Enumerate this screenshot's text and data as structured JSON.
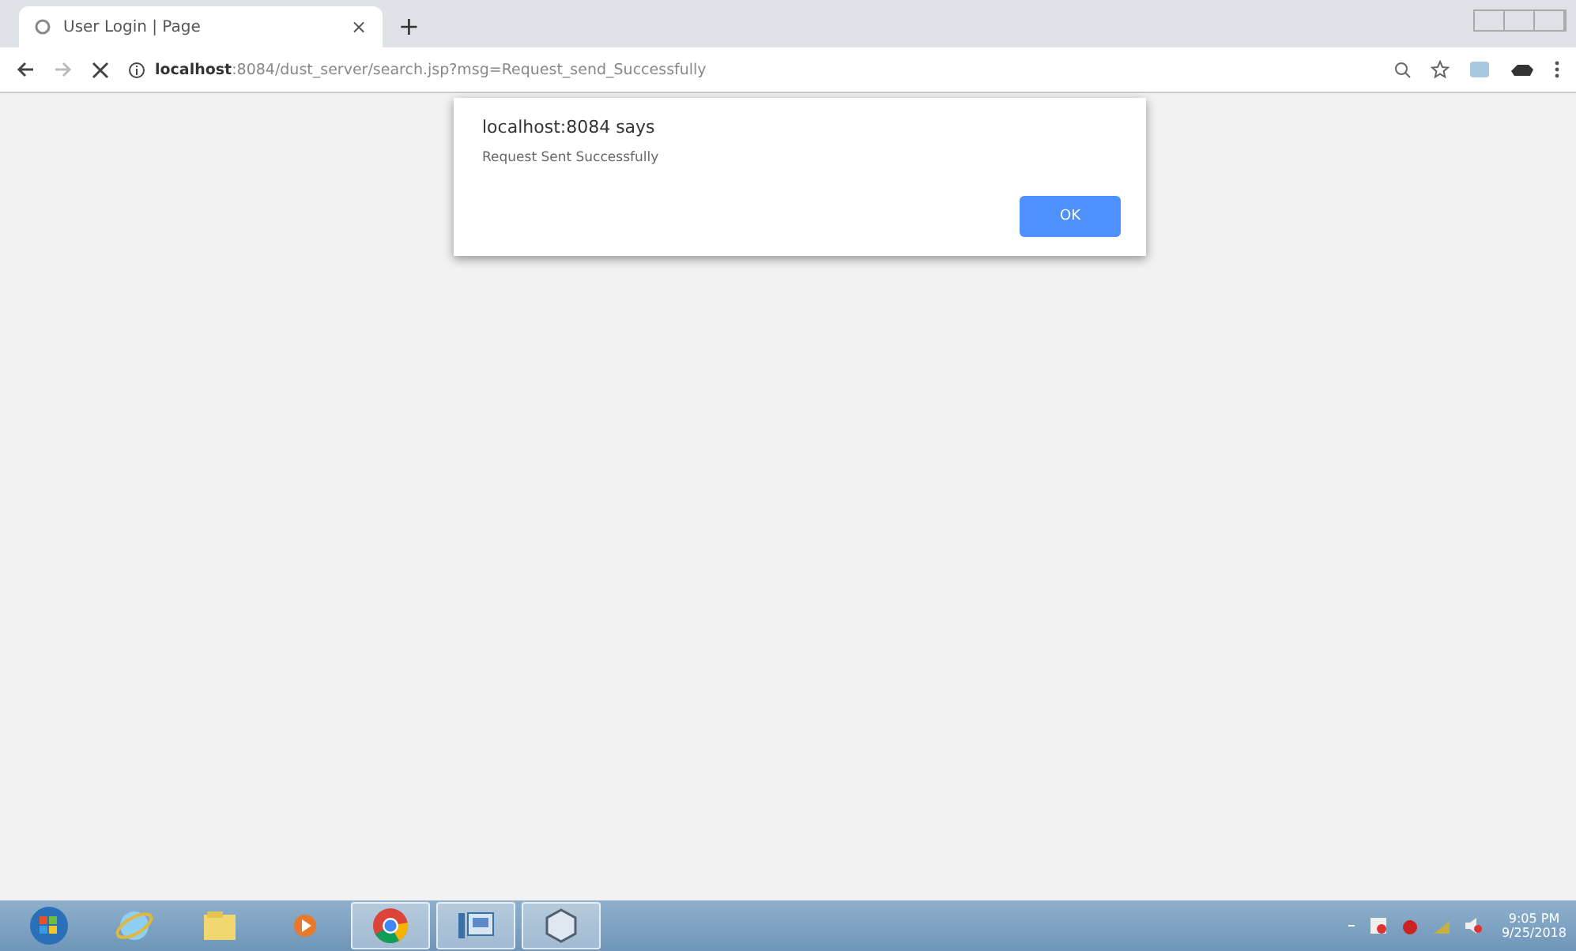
{
  "tab": {
    "title": "User Login | Page",
    "close": "×"
  },
  "new_tab": "+",
  "address_bar": {
    "host": "localhost",
    "rest": ":8084/dust_server/search.jsp?msg=Request_send_Successfully"
  },
  "dialog": {
    "title": "localhost:8084 says",
    "message": "Request Sent Successfully",
    "button": "OK"
  },
  "taskbar": {
    "apps": [
      {
        "kind": "start",
        "selected": false
      },
      {
        "kind": "ie",
        "selected": false
      },
      {
        "kind": "folder",
        "selected": false
      },
      {
        "kind": "media",
        "selected": false
      },
      {
        "kind": "chrome",
        "selected": true
      },
      {
        "kind": "window",
        "selected": true
      },
      {
        "kind": "cube",
        "selected": true
      }
    ],
    "time": "9:05 PM",
    "date": "9/25/2018"
  }
}
